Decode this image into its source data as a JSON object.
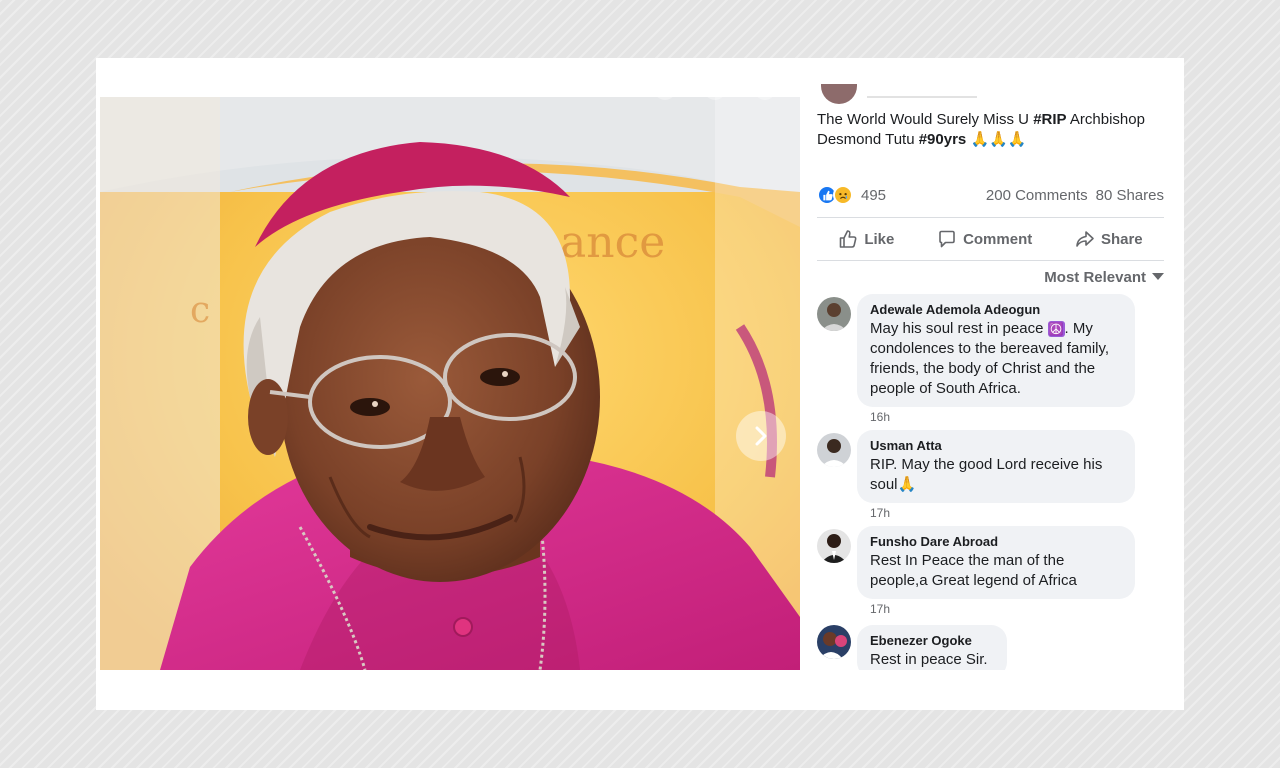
{
  "post": {
    "text_parts": [
      "The World Would Surely Miss U ",
      "#RIP",
      " Archbishop Desmond Tutu ",
      "#90yrs",
      " 🙏🙏🙏"
    ],
    "reaction_count": "495",
    "comments_count": "200 Comments",
    "shares_count": "80 Shares"
  },
  "actions": {
    "like_label": "Like",
    "comment_label": "Comment",
    "share_label": "Share"
  },
  "sort": {
    "label": "Most Relevant"
  },
  "comments": [
    {
      "name": "Adewale Ademola Adeogun",
      "text_before": "May his soul rest in peace ",
      "emoji": "☮️",
      "text_after": ". My condolences to the bereaved family, friends, the body of Christ and the people of South Africa.",
      "time": "16h"
    },
    {
      "name": "Usman Atta",
      "text": "RIP. May the good Lord receive his soul🙏",
      "time": "17h"
    },
    {
      "name": "Funsho Dare Abroad",
      "text": "Rest In Peace the man of the people,a Great legend of Africa",
      "time": "17h"
    },
    {
      "name": "Ebenezer Ogoke",
      "text": "Rest in peace Sir."
    }
  ],
  "colors": {
    "like_blue": "#1877f2",
    "sad_yellow": "#f7b928",
    "robe_magenta": "#d0247e",
    "text_secondary": "#65676b"
  },
  "icons": [
    "chevron-right-icon",
    "like-icon",
    "comment-icon",
    "share-icon",
    "caret-down-icon",
    "like-reaction-icon",
    "sad-reaction-icon"
  ]
}
